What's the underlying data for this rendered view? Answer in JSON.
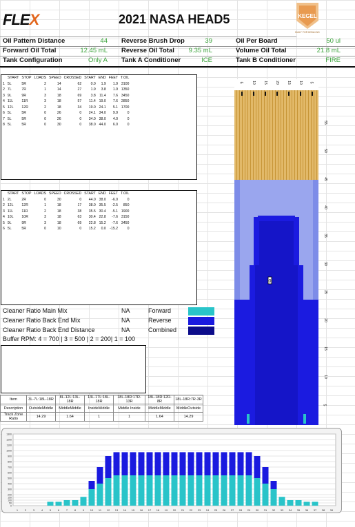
{
  "header": {
    "logo_main": "FLE",
    "logo_x": "X",
    "title": "2021 NASA HEAD5",
    "kegel_word": "KEGEL",
    "kegel_sub": "BUILT FOR BOWLING"
  },
  "summary": [
    {
      "label": "Oil Pattern Distance",
      "value": "44"
    },
    {
      "label": "Reverse Brush Drop",
      "value": "39"
    },
    {
      "label": "Oil Per Board",
      "value": "50 ul"
    },
    {
      "label": "Forward Oil Total",
      "value": "12.45 mL"
    },
    {
      "label": "Reverse Oil Total",
      "value": "9.35 mL"
    },
    {
      "label": "Volume Oil Total",
      "value": "21.8 mL"
    },
    {
      "label": "Tank Configuration",
      "value": "Only A"
    },
    {
      "label": "Tank A Conditioner",
      "value": "ICE"
    },
    {
      "label": "Tank B Conditioner",
      "value": "FIRE"
    }
  ],
  "forward_table": {
    "headers": [
      "START",
      "STOP",
      "LOADS",
      "SPEED",
      "CROSSED",
      "START",
      "END",
      "FEET",
      "T.OIL"
    ],
    "rows": [
      [
        "1",
        "5L",
        "5R",
        "2",
        "14",
        "62",
        "0.0",
        "1.9",
        "1.9",
        "3100"
      ],
      [
        "2",
        "7L",
        "7R",
        "1",
        "14",
        "27",
        "1.9",
        "3.8",
        "1.9",
        "1350"
      ],
      [
        "3",
        "9L",
        "9R",
        "3",
        "18",
        "69",
        "3.8",
        "11.4",
        "7.6",
        "3450"
      ],
      [
        "4",
        "11L",
        "11R",
        "3",
        "18",
        "57",
        "11.4",
        "19.0",
        "7.6",
        "2850"
      ],
      [
        "5",
        "12L",
        "12R",
        "2",
        "18",
        "34",
        "19.0",
        "24.1",
        "5.1",
        "1700"
      ],
      [
        "6",
        "5L",
        "5R",
        "0",
        "26",
        "0",
        "24.1",
        "34.0",
        "9.9",
        "0"
      ],
      [
        "7",
        "5L",
        "5R",
        "0",
        "26",
        "0",
        "34.0",
        "38.0",
        "4.0",
        "0"
      ],
      [
        "8",
        "5L",
        "5R",
        "0",
        "30",
        "0",
        "38.0",
        "44.0",
        "6.0",
        "0"
      ]
    ]
  },
  "reverse_table": {
    "headers": [
      "START",
      "STOP",
      "LOADS",
      "SPEED",
      "CROSSED",
      "START",
      "END",
      "FEET",
      "T.OIL"
    ],
    "rows": [
      [
        "1",
        "2L",
        "2R",
        "0",
        "30",
        "0",
        "44.0",
        "38.0",
        "-6.0",
        "0"
      ],
      [
        "2",
        "12L",
        "12R",
        "1",
        "18",
        "17",
        "38.0",
        "35.5",
        "-2.5",
        "850"
      ],
      [
        "3",
        "11L",
        "11R",
        "2",
        "18",
        "38",
        "35.5",
        "30.4",
        "-5.1",
        "1900"
      ],
      [
        "4",
        "10L",
        "10R",
        "3",
        "18",
        "63",
        "30.4",
        "22.8",
        "-7.6",
        "3150"
      ],
      [
        "5",
        "9L",
        "9R",
        "3",
        "18",
        "69",
        "22.8",
        "15.2",
        "-7.6",
        "3450"
      ],
      [
        "6",
        "5L",
        "5R",
        "0",
        "10",
        "0",
        "15.2",
        "0.0",
        "-15.2",
        "0"
      ]
    ]
  },
  "cleaner": [
    {
      "label": "Cleaner Ratio Main Mix",
      "value": "NA",
      "legend": "Forward",
      "color": "#29c4c9"
    },
    {
      "label": "Cleaner Ratio Back End Mix",
      "value": "NA",
      "legend": "Reverse",
      "color": "#1a1adf"
    },
    {
      "label": "Cleaner Ratio Back End Distance",
      "value": "NA",
      "legend": "Combined",
      "color": "#0c0c8a"
    }
  ],
  "buffer": "Buffer RPM: 4 = 700 | 3 = 500 | 2 = 200| 1 = 100",
  "zone_table": {
    "columns": [
      "Item",
      "3L-7L:18L-18R",
      "8L-12L:13L-18R",
      "13L-17L:18L-18R",
      "18L-18R:17R-13R",
      "18L-18R:12R-8R",
      "18L-18R:7R-3R"
    ],
    "description": [
      "Description",
      "OutsideMiddle",
      "MiddleMiddle",
      "InsideMiddle",
      "Middle Inside",
      "MiddleMiddle",
      "MiddleOutside"
    ],
    "ratio": [
      "Track Zone Ratio",
      "14.29",
      "1.64",
      "1",
      "1",
      "1.64",
      "14.29"
    ]
  },
  "lane": {
    "top_marks": [
      "5",
      "10",
      "15",
      "20",
      "15",
      "10",
      "5"
    ],
    "distance_marks": [
      "5",
      "10",
      "15",
      "20",
      "25",
      "30",
      "35",
      "40",
      "45",
      "50",
      "55"
    ],
    "arrow_label": "0"
  },
  "chart_data": {
    "type": "bar",
    "categories": [
      "1",
      "2",
      "3",
      "4",
      "5",
      "6",
      "7",
      "8",
      "9",
      "10",
      "11",
      "12",
      "13",
      "14",
      "15",
      "16",
      "17",
      "18",
      "19",
      "20",
      "21",
      "22",
      "23",
      "24",
      "25",
      "26",
      "27",
      "28",
      "29",
      "30",
      "31",
      "32",
      "33",
      "34",
      "35",
      "36",
      "37",
      "38",
      "39"
    ],
    "ylabels": [
      "0",
      "50",
      "100",
      "150",
      "200",
      "300",
      "400",
      "500",
      "600",
      "700",
      "800",
      "900",
      "1000",
      "1100",
      "1200",
      "1300"
    ],
    "ylim": [
      0,
      1300
    ],
    "series": [
      {
        "name": "Forward",
        "color": "#29c4c9",
        "values": [
          0,
          0,
          0,
          0,
          70,
          70,
          100,
          100,
          160,
          300,
          400,
          500,
          550,
          550,
          550,
          550,
          550,
          550,
          550,
          550,
          550,
          550,
          550,
          550,
          550,
          550,
          550,
          550,
          550,
          500,
          400,
          300,
          160,
          100,
          100,
          70,
          70,
          0,
          0
        ]
      },
      {
        "name": "Reverse",
        "color": "#1a1adf",
        "values": [
          0,
          0,
          0,
          0,
          0,
          0,
          0,
          0,
          0,
          150,
          300,
          400,
          420,
          420,
          420,
          420,
          420,
          420,
          420,
          420,
          420,
          420,
          420,
          420,
          420,
          420,
          420,
          420,
          420,
          400,
          300,
          150,
          0,
          0,
          0,
          0,
          0,
          0,
          0
        ]
      }
    ],
    "grid": true
  }
}
